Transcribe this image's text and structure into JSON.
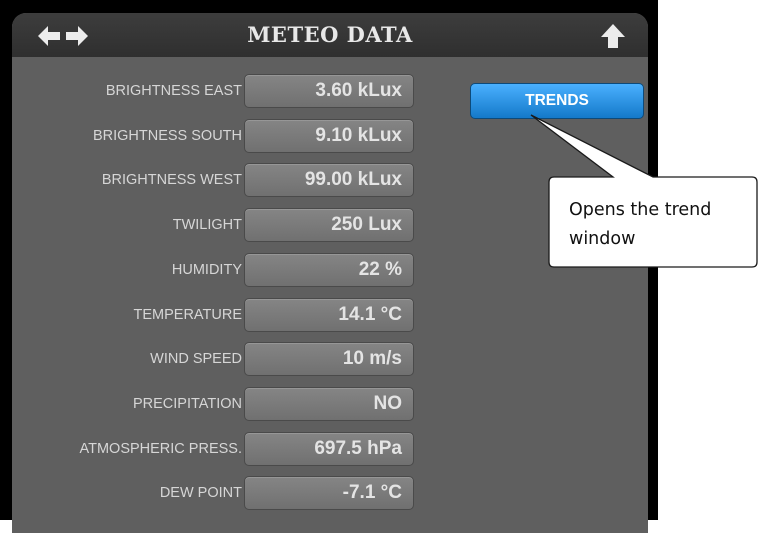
{
  "header": {
    "title": "METEO DATA",
    "left_icon": "left-right-arrows-icon",
    "right_icon": "arrow-up-icon"
  },
  "rows": [
    {
      "label": "BRIGHTNESS EAST",
      "value": "3.60 kLux"
    },
    {
      "label": "BRIGHTNESS SOUTH",
      "value": "9.10 kLux"
    },
    {
      "label": "BRIGHTNESS WEST",
      "value": "99.00 kLux"
    },
    {
      "label": "TWILIGHT",
      "value": "250 Lux"
    },
    {
      "label": "HUMIDITY",
      "value": "22 %"
    },
    {
      "label": "TEMPERATURE",
      "value": "14.1 °C"
    },
    {
      "label": "WIND SPEED",
      "value": "10 m/s"
    },
    {
      "label": "PRECIPITATION",
      "value": "NO"
    },
    {
      "label": "ATMOSPHERIC PRESS.",
      "value": "697.5 hPa"
    },
    {
      "label": "DEW POINT",
      "value": "-7.1 °C"
    }
  ],
  "trends_button": {
    "label": "TRENDS"
  },
  "callout": {
    "text": "Opens the trend window"
  },
  "colors": {
    "panel_background": "#5f5f5f",
    "header_background": "#333333",
    "value_box": "#7a7a7a",
    "trends_button": "#2a93e6",
    "callout_fill": "#ffffff"
  }
}
